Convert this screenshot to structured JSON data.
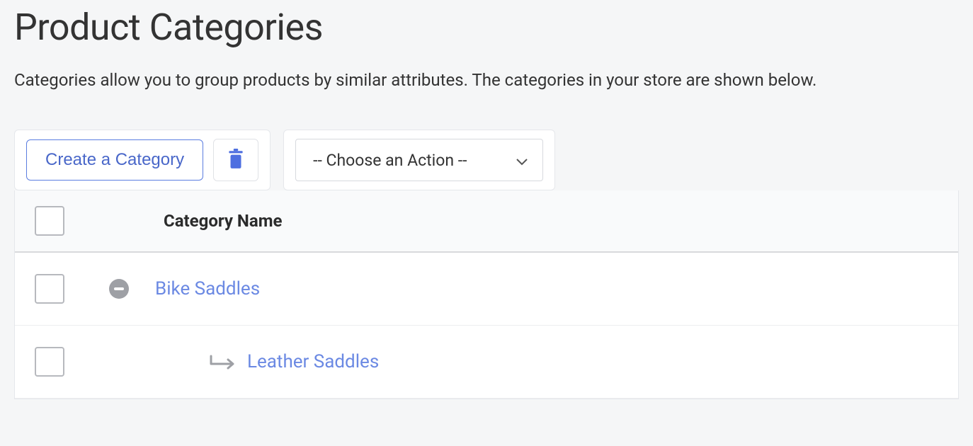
{
  "header": {
    "title": "Product Categories",
    "subtitle": "Categories allow you to group products by similar attributes. The categories in your store are shown below."
  },
  "toolbar": {
    "create_label": "Create a Category",
    "action_select": "-- Choose an Action --"
  },
  "table": {
    "header": {
      "name_col": "Category Name"
    },
    "rows": [
      {
        "name": "Bike Saddles"
      },
      {
        "name": "Leather Saddles"
      }
    ]
  }
}
